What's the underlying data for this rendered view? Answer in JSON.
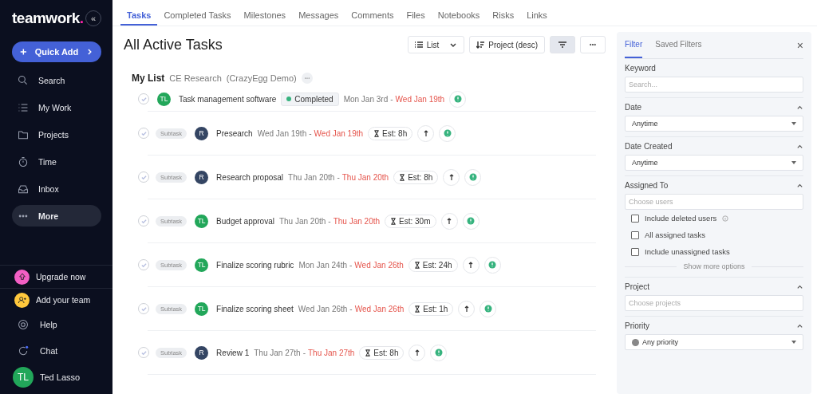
{
  "sidebar": {
    "logo": {
      "text": "teamwork",
      "dot": "."
    },
    "collapse": "«",
    "quick_add": "Quick Add",
    "nav": [
      {
        "label": "Search",
        "selected": false
      },
      {
        "label": "My Work",
        "selected": false
      },
      {
        "label": "Projects",
        "selected": false
      },
      {
        "label": "Time",
        "selected": false
      },
      {
        "label": "Inbox",
        "selected": false
      },
      {
        "label": "More",
        "selected": true
      }
    ],
    "promos": [
      {
        "label": "Upgrade now",
        "color": "#f25fc4"
      },
      {
        "label": "Add your team",
        "color": "#ffc83d"
      }
    ],
    "footer": [
      {
        "label": "Help"
      },
      {
        "label": "Chat"
      }
    ],
    "user": {
      "initials": "TL",
      "name": "Ted Lasso"
    }
  },
  "tabs": [
    {
      "label": "Tasks",
      "selected": true
    },
    {
      "label": "Completed Tasks",
      "selected": false
    },
    {
      "label": "Milestones",
      "selected": false
    },
    {
      "label": "Messages",
      "selected": false
    },
    {
      "label": "Comments",
      "selected": false
    },
    {
      "label": "Files",
      "selected": false
    },
    {
      "label": "Notebooks",
      "selected": false
    },
    {
      "label": "Risks",
      "selected": false
    },
    {
      "label": "Links",
      "selected": false
    }
  ],
  "title": "All Active Tasks",
  "toolbar": {
    "view": "List",
    "sort": "Project (desc)",
    "filter_active": true
  },
  "list": {
    "title": "My List",
    "project": "CE Research",
    "company": "(CrazyEgg Demo)"
  },
  "tasks": [
    {
      "kind": "task",
      "initials": "TL",
      "color": "#22a75a",
      "name": "Task management software",
      "status": "Completed",
      "start": "Mon Jan 3rd",
      "sep": "-",
      "end": "Wed Jan 19th"
    },
    {
      "kind": "subtask",
      "tag": "Subtask",
      "initials": "R",
      "color": "#344563",
      "name": "Presearch",
      "start": "Wed Jan 19th",
      "sep": "-",
      "end": "Wed Jan 19th",
      "estimate": "Est: 8h"
    },
    {
      "kind": "subtask",
      "tag": "Subtask",
      "initials": "R",
      "color": "#344563",
      "name": "Research proposal",
      "start": "Thu Jan 20th",
      "sep": "-",
      "end": "Thu Jan 20th",
      "estimate": "Est: 8h"
    },
    {
      "kind": "subtask",
      "tag": "Subtask",
      "initials": "TL",
      "color": "#22a75a",
      "name": "Budget approval",
      "start": "Thu Jan 20th",
      "sep": "-",
      "end": "Thu Jan 20th",
      "estimate": "Est: 30m"
    },
    {
      "kind": "subtask",
      "tag": "Subtask",
      "initials": "TL",
      "color": "#22a75a",
      "name": "Finalize scoring rubric",
      "start": "Mon Jan 24th",
      "sep": "-",
      "end": "Wed Jan 26th",
      "estimate": "Est: 24h"
    },
    {
      "kind": "subtask",
      "tag": "Subtask",
      "initials": "TL",
      "color": "#22a75a",
      "name": "Finalize scoring sheet",
      "start": "Wed Jan 26th",
      "sep": "-",
      "end": "Wed Jan 26th",
      "estimate": "Est: 1h"
    },
    {
      "kind": "subtask",
      "tag": "Subtask",
      "initials": "R",
      "color": "#344563",
      "name": "Review 1",
      "start": "Thu Jan 27th",
      "sep": "-",
      "end": "Thu Jan 27th",
      "estimate": "Est: 8h"
    }
  ],
  "filter": {
    "tabs": [
      {
        "label": "Filter",
        "selected": true
      },
      {
        "label": "Saved Filters",
        "selected": false
      }
    ],
    "close": "×",
    "sections": [
      {
        "kind": "text",
        "label": "Keyword",
        "placeholder": "Search..."
      },
      {
        "kind": "select",
        "label": "Date",
        "value": "Anytime",
        "expanded": true
      },
      {
        "kind": "select",
        "label": "Date Created",
        "value": "Anytime",
        "expanded": true
      },
      {
        "kind": "users",
        "label": "Assigned To",
        "placeholder": "Choose users",
        "expanded": true,
        "options": [
          {
            "label": "Include deleted users",
            "checked": false,
            "info": true
          },
          {
            "label": "All assigned tasks",
            "checked": false,
            "info": false
          },
          {
            "label": "Include unassigned tasks",
            "checked": false,
            "info": false
          }
        ],
        "more": "Show more options"
      },
      {
        "kind": "users",
        "label": "Project",
        "placeholder": "Choose projects",
        "expanded": true
      },
      {
        "kind": "priority",
        "label": "Priority",
        "value": "Any priority",
        "expanded": true
      }
    ]
  }
}
